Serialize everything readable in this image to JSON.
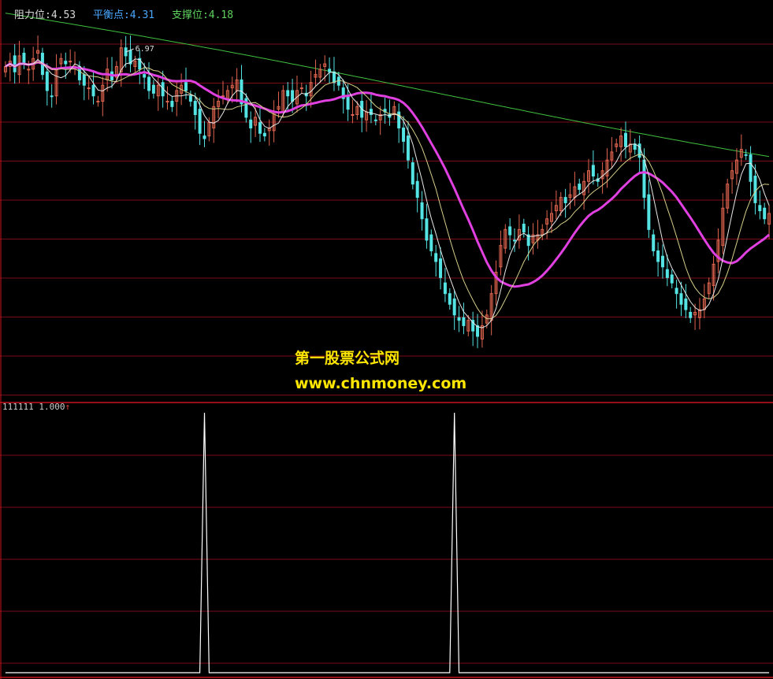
{
  "legend": {
    "resistance": "阻力位:4.53",
    "balance": "平衡点:4.31",
    "support": "支撑位:4.18"
  },
  "colors": {
    "background": "#000000",
    "grid": "#7a0c18",
    "panel_border": "#c8141e",
    "resistance": "#d8d8d8",
    "balance": "#4aa8ff",
    "support": "#5fd25f",
    "up_candle": "#e0654f",
    "down_candle": "#54e4e4",
    "ma_white": "#e8e8e8",
    "ma_yellow": "#d6cf8a",
    "ma_magenta": "#e040e0",
    "ma_green": "#3fbf3f",
    "signal": "#ffffff",
    "watermark": "#ffe600"
  },
  "watermark": {
    "line1": "第一股票公式网",
    "line2": "www.chnmoney.com"
  },
  "chart_data": [
    {
      "type": "candlestick",
      "panel": "main",
      "price_range": [
        3.55,
        4.98
      ],
      "high_label": "6.97",
      "close": [
        4.79,
        4.81,
        4.77,
        4.83,
        4.8,
        4.78,
        4.82,
        4.85,
        4.76,
        4.7,
        4.68,
        4.78,
        4.82,
        4.8,
        4.81,
        4.79,
        4.74,
        4.72,
        4.71,
        4.68,
        4.66,
        4.72,
        4.78,
        4.74,
        4.79,
        4.86,
        4.83,
        4.8,
        4.81,
        4.78,
        4.75,
        4.7,
        4.69,
        4.72,
        4.68,
        4.66,
        4.64,
        4.7,
        4.72,
        4.7,
        4.66,
        4.61,
        4.54,
        4.52,
        4.58,
        4.64,
        4.66,
        4.68,
        4.7,
        4.72,
        4.74,
        4.65,
        4.6,
        4.56,
        4.6,
        4.54,
        4.53,
        4.56,
        4.62,
        4.64,
        4.7,
        4.68,
        4.66,
        4.7,
        4.71,
        4.68,
        4.73,
        4.76,
        4.78,
        4.8,
        4.77,
        4.73,
        4.72,
        4.67,
        4.63,
        4.61,
        4.64,
        4.6,
        4.62,
        4.61,
        4.59,
        4.61,
        4.62,
        4.6,
        4.64,
        4.56,
        4.51,
        4.44,
        4.35,
        4.3,
        4.22,
        4.14,
        4.1,
        4.06,
        4.0,
        3.94,
        3.9,
        3.86,
        3.84,
        3.82,
        3.84,
        3.8,
        3.78,
        3.82,
        3.86,
        3.94,
        4.02,
        4.12,
        4.18,
        4.16,
        4.14,
        4.18,
        4.17,
        4.12,
        4.16,
        4.16,
        4.18,
        4.22,
        4.24,
        4.27,
        4.3,
        4.28,
        4.31,
        4.34,
        4.33,
        4.36,
        4.4,
        4.38,
        4.36,
        4.4,
        4.44,
        4.47,
        4.5,
        4.53,
        4.49,
        4.5,
        4.48,
        4.45,
        4.3,
        4.18,
        4.1,
        4.06,
        4.04,
        4.0,
        3.98,
        3.94,
        3.9,
        3.88,
        3.85,
        3.87,
        3.88,
        3.92,
        3.98,
        4.05,
        4.14,
        4.26,
        4.35,
        4.4,
        4.44,
        4.48,
        4.46,
        4.36,
        4.28,
        4.25,
        4.22,
        4.24
      ],
      "overlays": [
        "white short MA",
        "yellow MA",
        "magenta thick MA",
        "green long MA"
      ]
    },
    {
      "type": "line",
      "panel": "sub",
      "name": "111111",
      "value_label": "1.000",
      "ylim": [
        0,
        1
      ],
      "spikes_at_index": [
        43,
        97
      ]
    }
  ]
}
